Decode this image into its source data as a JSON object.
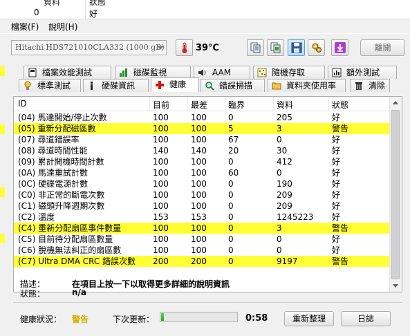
{
  "behind": {
    "headers": [
      "資料",
      "狀態"
    ],
    "values": [
      "0",
      "好"
    ]
  },
  "menu": [
    {
      "label": "檔案(F)"
    },
    {
      "label": "說明(H)"
    }
  ],
  "toolbar": {
    "drive": "Hitachi HDS721010CLA332 (1000 gB)",
    "temperature": "39℃",
    "unlock_label": "離開"
  },
  "tabs_back": [
    {
      "label": "檔案效能測試"
    },
    {
      "label": "磁碟監視"
    },
    {
      "label": "AAM"
    },
    {
      "label": "隨機存取"
    },
    {
      "label": "額外測試"
    }
  ],
  "tabs_front": [
    {
      "label": "標準測試"
    },
    {
      "label": "硬碟資訊"
    },
    {
      "label": "健康"
    },
    {
      "label": "錯誤掃描"
    },
    {
      "label": "資料夾使用率"
    },
    {
      "label": "清除"
    }
  ],
  "columns": [
    "ID",
    "目前",
    "最差",
    "臨界",
    "資料",
    "狀態"
  ],
  "rows": [
    {
      "id": "(04) 馬達開始/停止次數",
      "cur": "100",
      "worst": "100",
      "thr": "0",
      "data": "205",
      "status": "好",
      "warn": false
    },
    {
      "id": "(05) 重新分配磁區數",
      "cur": "100",
      "worst": "100",
      "thr": "5",
      "data": "3",
      "status": "警告",
      "warn": true
    },
    {
      "id": "(07) 尋道錯誤率",
      "cur": "100",
      "worst": "100",
      "thr": "67",
      "data": "0",
      "status": "好",
      "warn": false
    },
    {
      "id": "(08) 尋道時間性能",
      "cur": "140",
      "worst": "140",
      "thr": "20",
      "data": "30",
      "status": "好",
      "warn": false
    },
    {
      "id": "(09) 累計開機時間計數",
      "cur": "100",
      "worst": "100",
      "thr": "0",
      "data": "412",
      "status": "好",
      "warn": false
    },
    {
      "id": "(0A) 馬達重試計數",
      "cur": "100",
      "worst": "100",
      "thr": "60",
      "data": "0",
      "status": "好",
      "warn": false
    },
    {
      "id": "(0C) 硬碟電源計數",
      "cur": "100",
      "worst": "100",
      "thr": "0",
      "data": "190",
      "status": "好",
      "warn": false
    },
    {
      "id": "(C0) 非正常的斷電次數",
      "cur": "100",
      "worst": "100",
      "thr": "0",
      "data": "209",
      "status": "好",
      "warn": false
    },
    {
      "id": "(C1) 磁頭升降週期次數",
      "cur": "100",
      "worst": "100",
      "thr": "0",
      "data": "209",
      "status": "好",
      "warn": false
    },
    {
      "id": "(C2) 溫度",
      "cur": "153",
      "worst": "153",
      "thr": "0",
      "data": "1245223",
      "status": "好",
      "warn": false
    },
    {
      "id": "(C4) 重新分配扇區事件數量",
      "cur": "100",
      "worst": "100",
      "thr": "0",
      "data": "3",
      "status": "警告",
      "warn": true
    },
    {
      "id": "(C5) 目前待分配扇區數量",
      "cur": "100",
      "worst": "100",
      "thr": "0",
      "data": "0",
      "status": "好",
      "warn": false
    },
    {
      "id": "(C6) 脫機無法糾正的扇區數",
      "cur": "100",
      "worst": "100",
      "thr": "0",
      "data": "0",
      "status": "好",
      "warn": false
    },
    {
      "id": "(C7) Ultra DMA CRC 錯誤次數",
      "cur": "200",
      "worst": "200",
      "thr": "0",
      "data": "9197",
      "status": "警告",
      "warn": true
    }
  ],
  "description": {
    "label": "描述：",
    "text": "在項目上按一下以取得更多詳細的說明資訊",
    "status_label": "狀態：",
    "status_value": "n/a"
  },
  "footer": {
    "health_label": "健康狀況：",
    "health_value": "警告",
    "next_update_label": "下次更新：",
    "progress": 0.04,
    "countdown": "0:58",
    "refresh_label": "重新整理",
    "log_label": "日誌"
  },
  "colors": {
    "warn_highlight": "#ffff33",
    "warn_text": "#d4b300",
    "progress": "#2bbd2b"
  }
}
